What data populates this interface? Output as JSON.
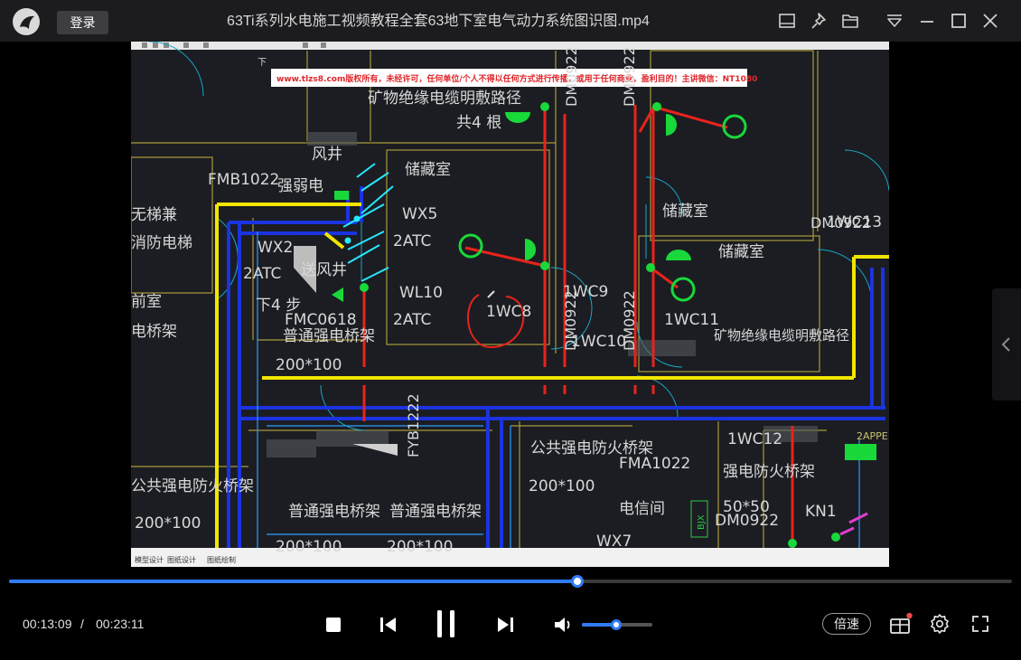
{
  "app": {
    "login_label": "登录",
    "window_title": "63Ti系列水电施工视频教程全套63地下室电气动力系统图识图.mp4"
  },
  "titlebar_icons": [
    "mini-player-icon",
    "pin-icon",
    "folder-icon",
    "menu-icon",
    "minimize-icon",
    "maximize-icon",
    "close-icon"
  ],
  "video": {
    "watermark": "www.tlzs8.com版权所有，未经许可，任何单位/个人不得以任何方式进行传播，或用于任何商业，盈利目的！主讲微信：NT1080",
    "drawing_labels": {
      "cable_route_top": "矿物绝缘电缆明敷路径",
      "count_4": "共4 根",
      "wind_shaft": "风井",
      "storage_1": "储藏室",
      "storage_2": "储藏室",
      "storage_3": "储藏室",
      "fmb": "FMB1022",
      "strong_weak": "强弱电",
      "wx5": "WX5",
      "atc_1": "2ATC",
      "wx2": "WX2",
      "atc_2": "2ATC",
      "smoke_shaft": "送风井",
      "down_4": "下4 步",
      "wl10": "WL10",
      "atc_3": "2ATC",
      "wc8": "1WC8",
      "wc9": "1WC9",
      "wc10": "1WC10",
      "wc11": "1WC11",
      "wc13": "1WC13",
      "dm0922_a": "DM0922",
      "dm0922_b": "DM0922",
      "dm0922_c": "DM0922",
      "dm0922_d": "DM0922",
      "fmc": "FMC0618",
      "tray_normal_1": "普通强电桥架",
      "size_1": "200*100",
      "cable_route_right": "矿物绝缘电缆明敷路径",
      "public_fire_tray": "公共强电防火桥架",
      "size_2": "200*100",
      "fma": "FMA1022",
      "wc12": "1WC12",
      "fire_tray": "强电防火桥架",
      "size_50": "50*50",
      "telecom_room": "电信间",
      "kn1": "KN1",
      "dm0922_e": "DM0922",
      "wx7": "WX7",
      "tray_public_left": "公共强电防火桥架",
      "size_3": "200*100",
      "tray_normal_2": "普通强电桥架",
      "tray_normal_3": "普通强电桥架",
      "size_4": "200*100",
      "size_5": "200*100",
      "fyb": "FYB1222",
      "elevator": "无梯兼",
      "elevator_2": "消防电梯",
      "front_room": "前室",
      "bridge_left": "电桥架",
      "dp_2appe": "2APPE",
      "down": "下",
      "bjx": "BJX",
      "dmb": "DM0922",
      "status_tab_1": "模型设计",
      "status_tab_2": "图纸设计",
      "status_tab_3": "图纸绘制"
    }
  },
  "playback": {
    "current_time": "00:13:09",
    "separator": "/",
    "total_time": "00:23:11",
    "progress_fraction": 0.567,
    "volume_fraction": 0.49,
    "speed_label": "倍速"
  },
  "controls_icons": [
    "stop-icon",
    "previous-icon",
    "pause-icon",
    "next-icon",
    "volume-icon",
    "gift-icon",
    "settings-icon",
    "fullscreen-icon"
  ],
  "colors": {
    "accent": "#2f7cf6",
    "titlebar": "#1c1c1f",
    "cad_bg": "#1b1d22"
  }
}
